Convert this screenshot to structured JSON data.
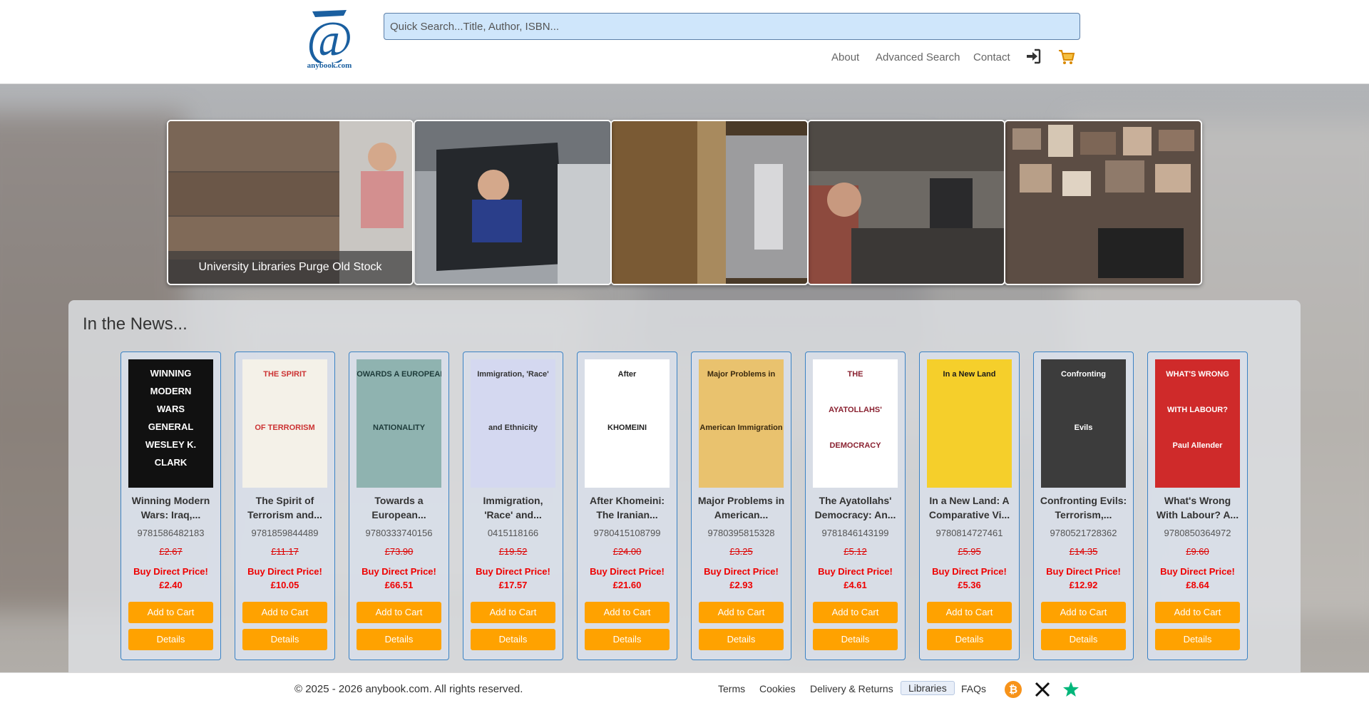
{
  "header": {
    "logo_text": "anybook.com",
    "search_placeholder": "Quick Search...Title, Author, ISBN...",
    "nav": [
      "About",
      "Advanced Search",
      "Contact"
    ]
  },
  "carousel": {
    "caption": "University Libraries Purge Old Stock"
  },
  "news": {
    "title": "In the News...",
    "books": [
      {
        "title": "Winning Modern Wars: Iraq,...",
        "isbn": "9781586482183",
        "rrp": "£2.67",
        "label": "Buy Direct Price!",
        "price": "£2.40"
      },
      {
        "title": "The Spirit of Terrorism and...",
        "isbn": "9781859844489",
        "rrp": "£11.17",
        "label": "Buy Direct Price!",
        "price": "£10.05"
      },
      {
        "title": "Towards a European...",
        "isbn": "9780333740156",
        "rrp": "£73.90",
        "label": "Buy Direct Price!",
        "price": "£66.51"
      },
      {
        "title": "Immigration, 'Race' and...",
        "isbn": "0415118166",
        "rrp": "£19.52",
        "label": "Buy Direct Price!",
        "price": "£17.57"
      },
      {
        "title": "After Khomeini: The Iranian...",
        "isbn": "9780415108799",
        "rrp": "£24.00",
        "label": "Buy Direct Price!",
        "price": "£21.60"
      },
      {
        "title": "Major Problems in American...",
        "isbn": "9780395815328",
        "rrp": "£3.25",
        "label": "Buy Direct Price!",
        "price": "£2.93"
      },
      {
        "title": "The Ayatollahs' Democracy: An...",
        "isbn": "9781846143199",
        "rrp": "£5.12",
        "label": "Buy Direct Price!",
        "price": "£4.61"
      },
      {
        "title": "In a New Land: A Comparative Vi...",
        "isbn": "9780814727461",
        "rrp": "£5.95",
        "label": "Buy Direct Price!",
        "price": "£5.36"
      },
      {
        "title": "Confronting Evils: Terrorism,...",
        "isbn": "9780521728362",
        "rrp": "£14.35",
        "label": "Buy Direct Price!",
        "price": "£12.92"
      },
      {
        "title": "What's Wrong With Labour? A...",
        "isbn": "9780850364972",
        "rrp": "£9.60",
        "label": "Buy Direct Price!",
        "price": "£8.64"
      }
    ],
    "add_label": "Add to Cart",
    "details_label": "Details"
  },
  "covers": [
    {
      "lines": [
        "WINNING",
        "MODERN",
        "WARS",
        "GENERAL",
        "WESLEY K.",
        "CLARK"
      ],
      "bg": "#111111",
      "fg": "#ffffff"
    },
    {
      "lines": [
        "THE SPIRIT",
        "OF TERRORISM"
      ],
      "bg": "#f4f1e8",
      "fg": "#c33"
    },
    {
      "lines": [
        "TOWARDS A EUROPEAN",
        "NATIONALITY"
      ],
      "bg": "#8fb3b0",
      "fg": "#1e3b3a"
    },
    {
      "lines": [
        "Immigration, 'Race'",
        "and Ethnicity"
      ],
      "bg": "#d4d8f0",
      "fg": "#333"
    },
    {
      "lines": [
        "After",
        "KHOMEINI"
      ],
      "bg": "#ffffff",
      "fg": "#222"
    },
    {
      "lines": [
        "Major Problems in",
        "American Immigration"
      ],
      "bg": "#e9c26e",
      "fg": "#3a2a10"
    },
    {
      "lines": [
        "THE",
        "AYATOLLAHS'",
        "DEMOCRACY"
      ],
      "bg": "#ffffff",
      "fg": "#8a2231"
    },
    {
      "lines": [
        "In a New Land"
      ],
      "bg": "#f5cf2b",
      "fg": "#1a1a1a"
    },
    {
      "lines": [
        "Confronting",
        "Evils"
      ],
      "bg": "#3c3c3c",
      "fg": "#ffffff"
    },
    {
      "lines": [
        "WHAT'S WRONG",
        "WITH LABOUR?",
        "Paul Allender"
      ],
      "bg": "#cf2a2a",
      "fg": "#ffffff"
    }
  ],
  "footer": {
    "copyright": "© 2025 - 2026 anybook.com. All rights reserved.",
    "links": [
      "Terms",
      "Cookies",
      "Delivery & Returns",
      "Libraries",
      "FAQs"
    ]
  },
  "colors": {
    "accent": "#ffa200",
    "price_red": "#e00000",
    "card_border": "#3b82c4",
    "brand_blue": "#1a5fa0"
  }
}
